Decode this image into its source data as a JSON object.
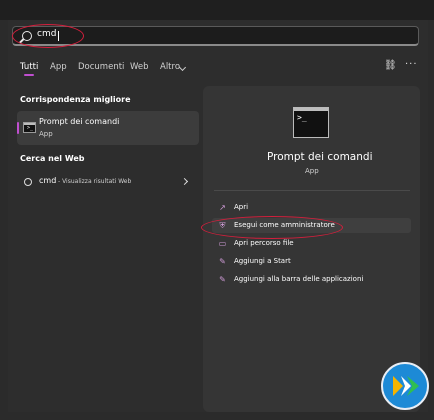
{
  "search": {
    "query": "cmd"
  },
  "tabs": [
    {
      "label": "Tutti",
      "active": true
    },
    {
      "label": "App"
    },
    {
      "label": "Documenti"
    },
    {
      "label": "Web"
    },
    {
      "label": "Altro"
    }
  ],
  "sections": {
    "best_match": "Corrispondenza migliore",
    "web": "Cerca nel Web"
  },
  "best_result": {
    "title": "Prompt dei comandi",
    "subtitle": "App"
  },
  "web_result": {
    "query": "cmd",
    "hint": "- Visualizza risultati Web"
  },
  "detail": {
    "title": "Prompt dei comandi",
    "subtitle": "App",
    "actions": [
      {
        "label": "Apri",
        "icon": "open-icon"
      },
      {
        "label": "Esegui come amministratore",
        "icon": "shield-icon",
        "highlighted": true
      },
      {
        "label": "Apri percorso file",
        "icon": "folder-icon"
      },
      {
        "label": "Aggiungi a Start",
        "icon": "pin-icon"
      },
      {
        "label": "Aggiungi alla barra delle applicazioni",
        "icon": "pin-icon"
      }
    ]
  },
  "colors": {
    "accent": "#c04fd0",
    "annotation": "#d21f3c",
    "background": "#2b2b2b"
  }
}
